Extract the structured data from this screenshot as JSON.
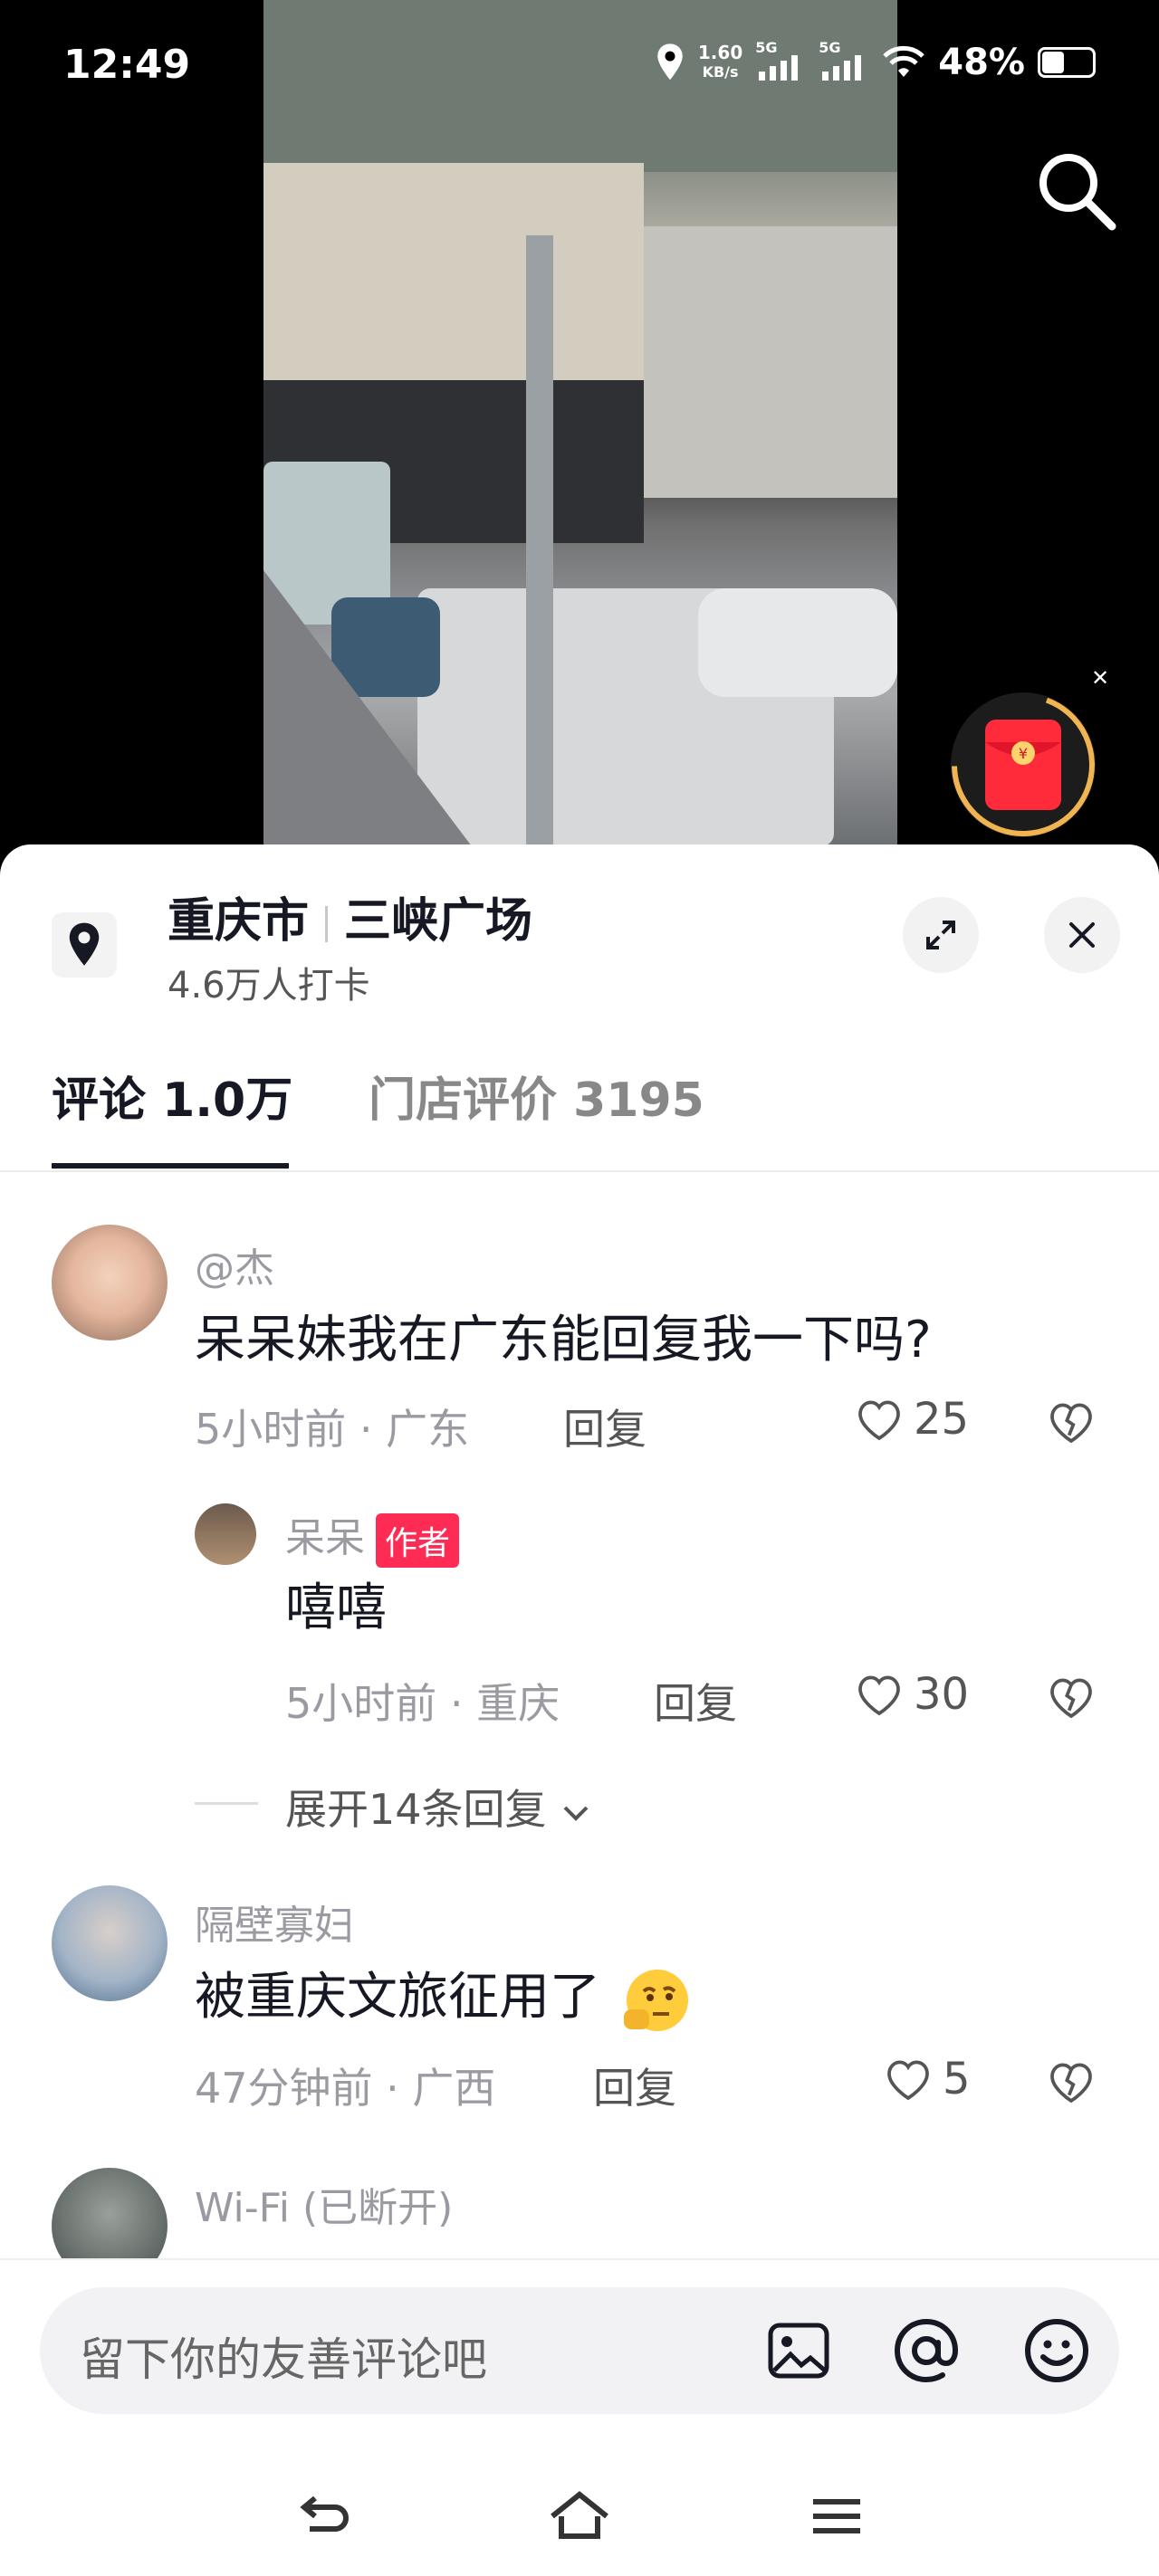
{
  "status": {
    "time": "12:49",
    "net_speed_value": "1.60",
    "net_speed_unit": "KB/s",
    "sim1": "5G",
    "sim2": "5G",
    "battery": "48%",
    "battery_level": 0.48
  },
  "location": {
    "city": "重庆市",
    "place": "三峡广场",
    "checkins": "4.6万人打卡"
  },
  "tabs": [
    {
      "label": "评论 1.0万"
    },
    {
      "label": "门店评价 3195"
    }
  ],
  "comments": [
    {
      "user": "@杰",
      "text": "呆呆妹我在广东能回复我一下吗?",
      "time_place": "5小时前 · 广东",
      "reply": "回复",
      "likes": "25"
    },
    {
      "user": "呆呆",
      "badge": "作者",
      "text": "嘻嘻",
      "time_place": "5小时前 · 重庆",
      "reply": "回复",
      "likes": "30"
    },
    {
      "user": "隔壁寡妇",
      "text": "被重庆文旅征用了",
      "time_place": "47分钟前 · 广西",
      "reply": "回复",
      "likes": "5"
    },
    {
      "user": "Wi-Fi (已断开)"
    }
  ],
  "expand_replies": "展开14条回复",
  "input": {
    "placeholder": "留下你的友善评论吧"
  },
  "icons": [
    "location-icon",
    "search-icon",
    "red-packet-icon",
    "expand-icon",
    "close-icon",
    "heart-icon",
    "dislike-icon",
    "image-icon",
    "at-icon",
    "emoji-icon",
    "back-icon",
    "home-icon",
    "menu-icon"
  ]
}
